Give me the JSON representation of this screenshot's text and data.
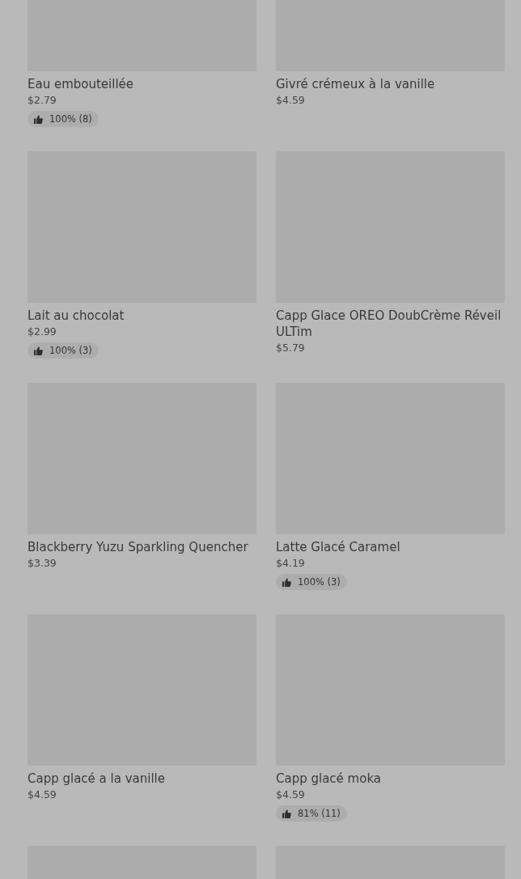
{
  "products": [
    {
      "kind": "product",
      "name": "Eau embouteillée",
      "price": "$2.79",
      "rating": "100% (8)"
    },
    {
      "kind": "product",
      "name": "Givré crémeux à la vanille",
      "price": "$4.59"
    },
    {
      "kind": "product",
      "name": "Lait au chocolat",
      "price": "$2.99",
      "rating": "100% (3)"
    },
    {
      "kind": "product",
      "name": "Capp Glace OREO DoubCrème Réveil ULTim",
      "price": "$5.79"
    },
    {
      "kind": "product",
      "name": "Blackberry Yuzu Sparkling Quencher",
      "price": "$3.39"
    },
    {
      "kind": "product",
      "name": "Latte Glacé Caramel",
      "price": "$4.19",
      "rating": "100% (3)"
    },
    {
      "kind": "product",
      "name": "Capp glacé a la vanille",
      "price": "$4.59"
    },
    {
      "kind": "product",
      "name": "Capp glacé moka",
      "price": "$4.59",
      "rating": "81% (11)"
    },
    {
      "kind": "image_only"
    },
    {
      "kind": "image_only"
    }
  ]
}
